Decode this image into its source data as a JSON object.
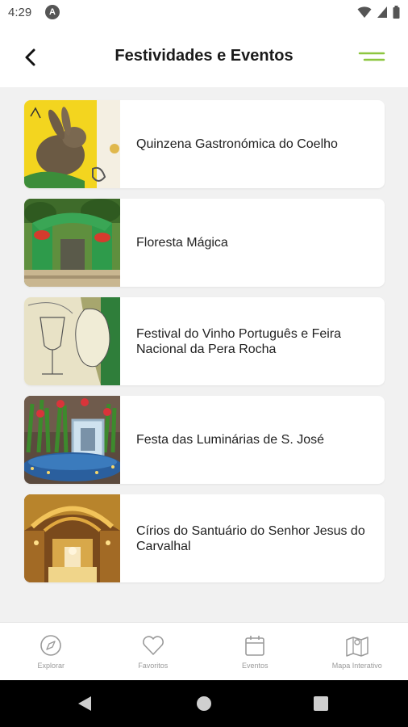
{
  "status_bar": {
    "time": "4:29",
    "app_icon": "A"
  },
  "header": {
    "title": "Festividades e Eventos",
    "accent": "#8cc63f"
  },
  "events": [
    {
      "title": "Quinzena Gastronómica do Coelho",
      "image": "rabbit-illustration"
    },
    {
      "title": "Floresta Mágica",
      "image": "forest-gate-photo"
    },
    {
      "title": "Festival do Vinho Português e Feira Nacional da Pera Rocha",
      "image": "wine-pear-illustration"
    },
    {
      "title": "Festa das Luminárias de S. José",
      "image": "flower-altar-photo"
    },
    {
      "title": "Círios do Santuário do Senhor Jesus do Carvalhal",
      "image": "golden-church-photo"
    }
  ],
  "bottom_nav": [
    {
      "label": "Explorar",
      "icon": "compass-icon"
    },
    {
      "label": "Favoritos",
      "icon": "heart-icon"
    },
    {
      "label": "Eventos",
      "icon": "calendar-icon"
    },
    {
      "label": "Mapa Interativo",
      "icon": "map-icon"
    }
  ]
}
